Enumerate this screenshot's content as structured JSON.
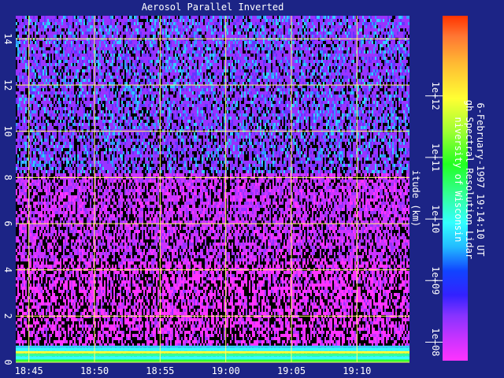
{
  "colors": {
    "background": "#1c2486",
    "grid": "#ffff66",
    "text": "#ffffff",
    "palette": [
      "#ff33ff",
      "#cc33ff",
      "#9933ff",
      "#6633ff",
      "#3333ff",
      "#3399ff",
      "#33ccff",
      "#33ffff",
      "#33ff99",
      "#33ff33",
      "#99ff33",
      "#ffff33",
      "#ffcc33",
      "#ff9933",
      "#ff6633",
      "#ff3300"
    ]
  },
  "chart_data": {
    "type": "heatmap",
    "title": "Aerosol Parallel Inverted",
    "ylabel": "itude (km)",
    "x_ticks": [
      "18:45",
      "18:50",
      "18:55",
      "19:00",
      "19:05",
      "19:10"
    ],
    "x_range": [
      "18:44",
      "19:14"
    ],
    "y_ticks": [
      "0",
      "2",
      "4",
      "6",
      "8",
      "10",
      "12",
      "14"
    ],
    "ylim": [
      0,
      15
    ],
    "grid": true,
    "colorbar": {
      "scale": "log",
      "ticks": [
        "1e+08",
        "1e+09",
        "1e+10",
        "1e+11",
        "1e+12"
      ],
      "range": [
        50000000,
        20000000000000
      ]
    },
    "side_text": [
      "niversity of Wisconsin",
      "gh Spectral Resolution Lidar",
      "6-February-1997 19:14:10 UT"
    ]
  }
}
